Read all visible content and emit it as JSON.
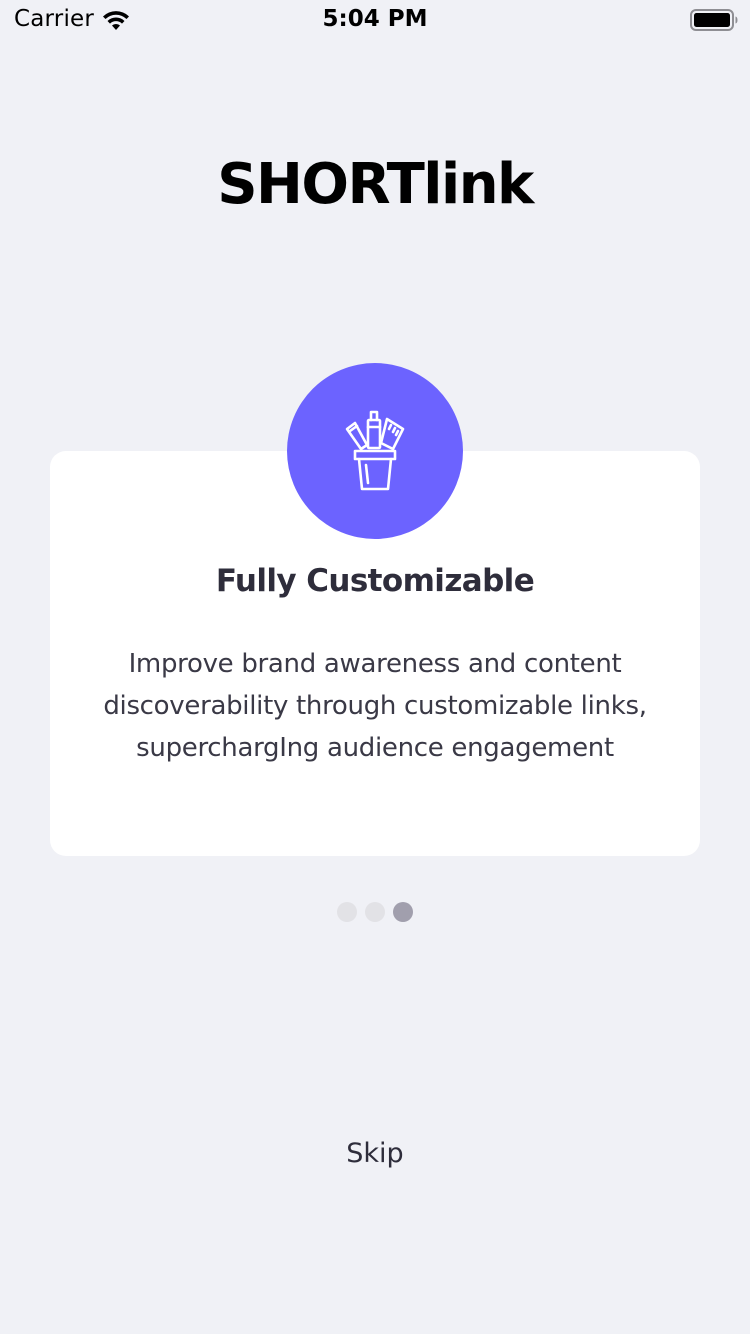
{
  "status_bar": {
    "carrier": "Carrier",
    "time": "5:04 PM",
    "wifi_icon": "wifi-icon",
    "battery_icon": "battery-icon"
  },
  "app_title": "SHORTlink",
  "card": {
    "icon": "pencil-cup-icon",
    "icon_bg_color": "#6c63ff",
    "title": "Fully Customizable",
    "description": "Improve brand awareness and content discoverability through customizable links, superchargIng audience engagement"
  },
  "pagination": {
    "total": 3,
    "active_index": 2,
    "active_color": "#a19fad",
    "inactive_color": "#e2e2e6"
  },
  "skip_label": "Skip",
  "colors": {
    "background": "#f0f1f6",
    "card": "#ffffff",
    "accent": "#6c63ff"
  }
}
